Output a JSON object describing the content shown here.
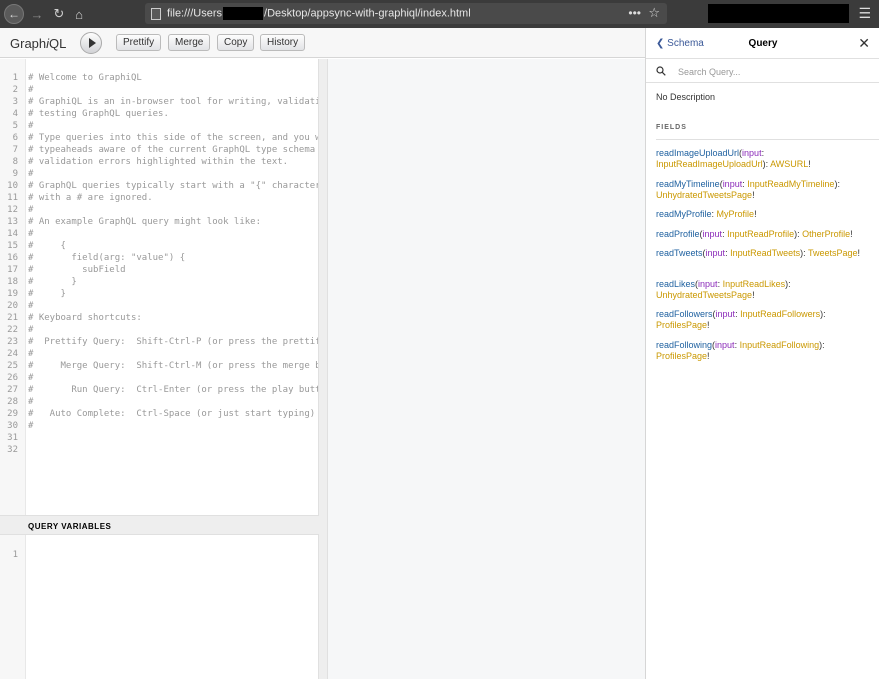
{
  "browser": {
    "url_prefix": "file:///Users",
    "url_suffix": "/Desktop/appsync-with-graphiql/index.html",
    "url_dots": "•••"
  },
  "toolbar": {
    "title_pre": "Graph",
    "title_em": "i",
    "title_post": "QL",
    "prettify": "Prettify",
    "merge": "Merge",
    "copy": "Copy",
    "history": "History"
  },
  "editor": {
    "lines": [
      "# Welcome to GraphiQL",
      "#",
      "# GraphiQL is an in-browser tool for writing, validating, and",
      "# testing GraphQL queries.",
      "#",
      "# Type queries into this side of the screen, and you will see intelligent",
      "# typeaheads aware of the current GraphQL type schema and live syntax and",
      "# validation errors highlighted within the text.",
      "#",
      "# GraphQL queries typically start with a \"{\" character. Lines that start",
      "# with a # are ignored.",
      "#",
      "# An example GraphQL query might look like:",
      "#",
      "#     {",
      "#       field(arg: \"value\") {",
      "#         subField",
      "#       }",
      "#     }",
      "#",
      "# Keyboard shortcuts:",
      "#",
      "#  Prettify Query:  Shift-Ctrl-P (or press the prettify button above)",
      "#",
      "#     Merge Query:  Shift-Ctrl-M (or press the merge button above)",
      "#",
      "#       Run Query:  Ctrl-Enter (or press the play button above)",
      "#",
      "#   Auto Complete:  Ctrl-Space (or just start typing)",
      "#",
      "",
      ""
    ]
  },
  "variables": {
    "header": "QUERY VARIABLES",
    "line_number": "1"
  },
  "docs": {
    "back_label": "Schema",
    "title": "Query",
    "search_placeholder": "Search Query...",
    "description": "No Description",
    "fields_label": "FIELDS",
    "fields": [
      {
        "name": "readImageUploadUrl",
        "arg": "input",
        "arg_type": "InputReadImageUploadUrl",
        "ret": "AWSURL"
      },
      {
        "name": "readMyTimeline",
        "arg": "input",
        "arg_type": "InputReadMyTimeline",
        "ret": "UnhydratedTweetsPage"
      },
      {
        "name": "readMyProfile",
        "arg": "",
        "arg_type": "",
        "ret": "MyProfile"
      },
      {
        "name": "readProfile",
        "arg": "input",
        "arg_type": "InputReadProfile",
        "ret": "OtherProfile"
      },
      {
        "name": "readTweets",
        "arg": "input",
        "arg_type": "InputReadTweets",
        "ret": "TweetsPage"
      },
      {
        "name": "readLikes",
        "arg": "input",
        "arg_type": "InputReadLikes",
        "ret": "UnhydratedTweetsPage"
      },
      {
        "name": "readFollowers",
        "arg": "input",
        "arg_type": "InputReadFollowers",
        "ret": "ProfilesPage"
      },
      {
        "name": "readFollowing",
        "arg": "input",
        "arg_type": "InputReadFollowing",
        "ret": "ProfilesPage"
      }
    ]
  }
}
